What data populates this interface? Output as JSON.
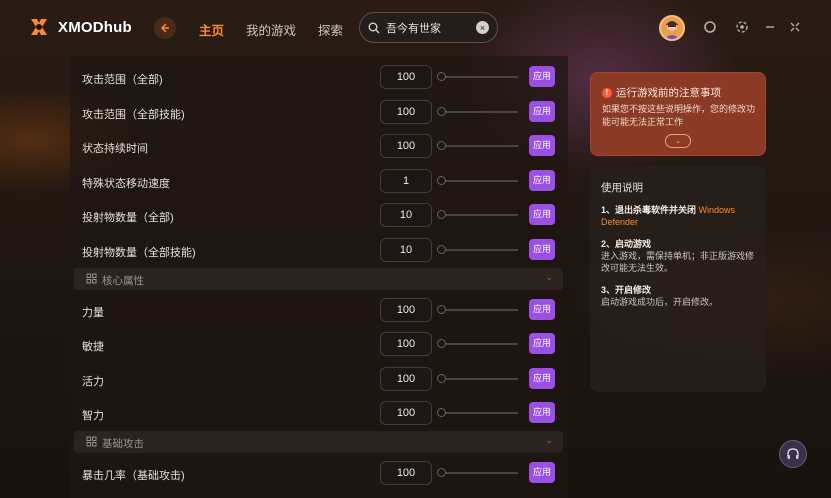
{
  "brand": {
    "name": "XMODhub"
  },
  "nav": {
    "items": [
      "主页",
      "我的游戏",
      "探索"
    ],
    "active": 0
  },
  "search": {
    "value": "吾今有世家"
  },
  "rows": [
    {
      "label": "攻击范围（全部)",
      "value": "100"
    },
    {
      "label": "攻击范围（全部技能)",
      "value": "100"
    },
    {
      "label": "状态持续时间",
      "value": "100"
    },
    {
      "label": "特殊状态移动速度",
      "value": "1"
    },
    {
      "label": "投射物数量（全部)",
      "value": "10"
    },
    {
      "label": "投射物数量（全部技能)",
      "value": "10"
    }
  ],
  "section_core": {
    "label": "核心属性"
  },
  "core_rows": [
    {
      "label": "力量",
      "value": "100"
    },
    {
      "label": "敏捷",
      "value": "100"
    },
    {
      "label": "活力",
      "value": "100"
    },
    {
      "label": "智力",
      "value": "100"
    }
  ],
  "section_basic": {
    "label": "基础攻击"
  },
  "basic_rows": [
    {
      "label": "暴击几率（基础攻击)",
      "value": "100"
    }
  ],
  "apply_label": "应用",
  "warning": {
    "title": "运行游戏前的注意事项",
    "body": "如果您不按这些说明操作，您的修改功能可能无法正常工作"
  },
  "guide": {
    "title": "使用说明",
    "step1_title": "1、退出杀毒软件并关闭",
    "step1_highlight": "Windows Defender",
    "step2_title": "2、启动游戏",
    "step2_body": "进入游戏，需保持单机；非正版游戏修改可能无法生效。",
    "step3_title": "3、开启修改",
    "step3_body": "启动游戏成功后，开启修改。"
  },
  "colors": {
    "accent": "#ff8a2a",
    "apply": "#9b4fe3",
    "warning": "#8a3a25"
  }
}
